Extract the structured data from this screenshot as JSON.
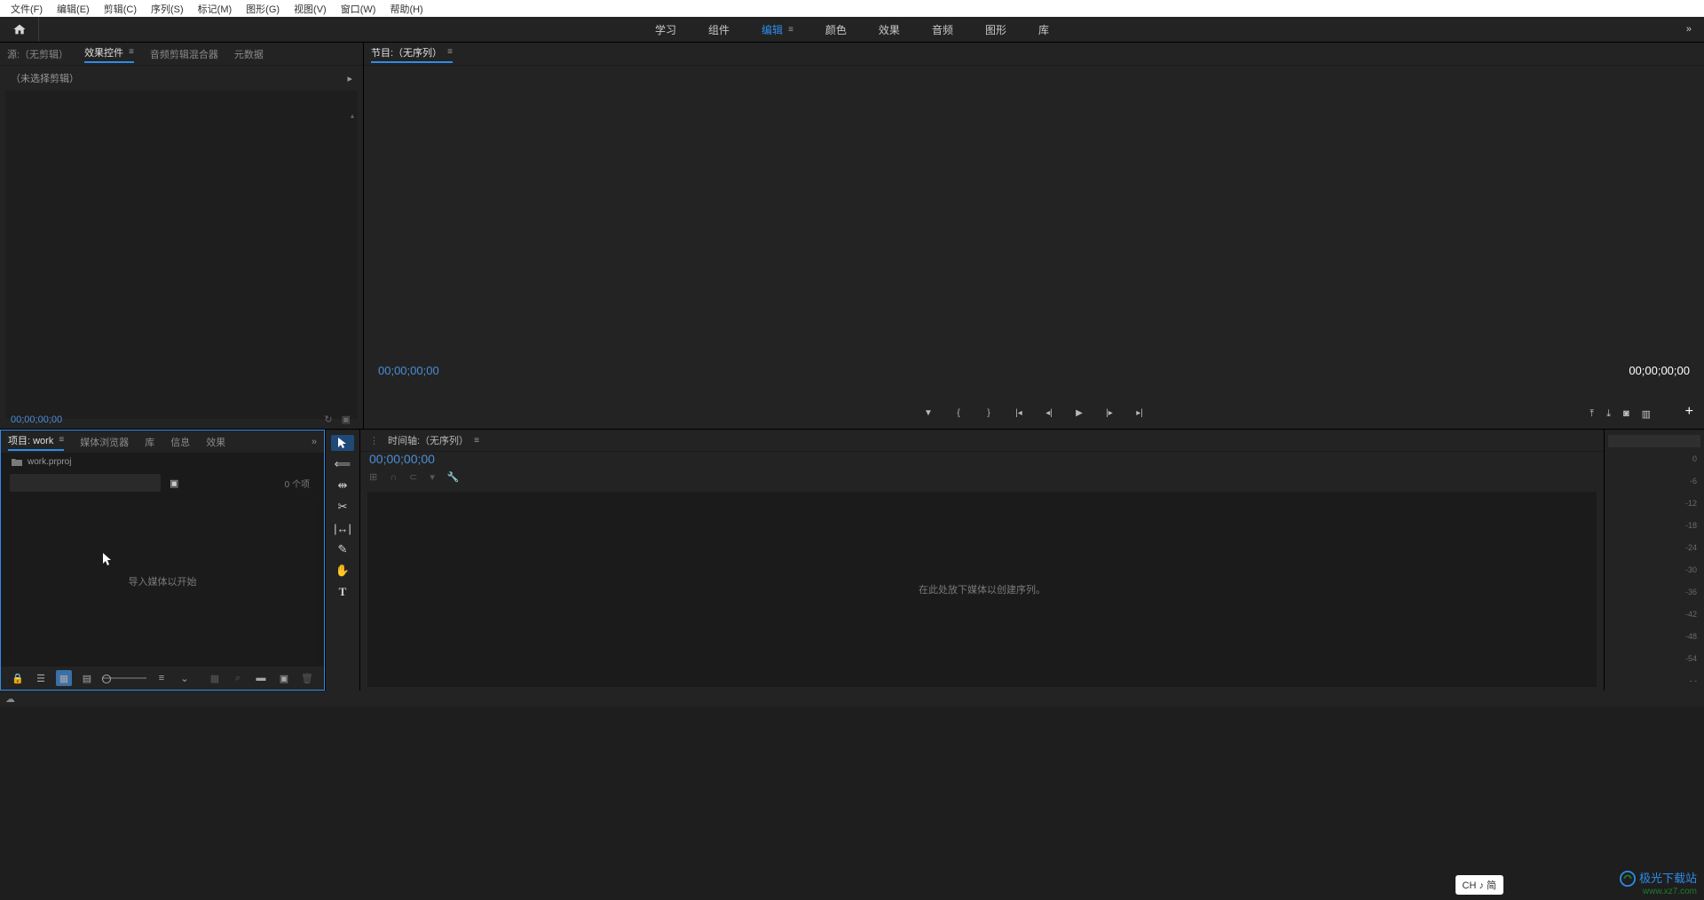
{
  "menubar": {
    "file": "文件(F)",
    "edit": "编辑(E)",
    "clip": "剪辑(C)",
    "sequence": "序列(S)",
    "marker": "标记(M)",
    "graphics": "图形(G)",
    "view": "视图(V)",
    "window": "窗口(W)",
    "help": "帮助(H)"
  },
  "workspaces": {
    "learn": "学习",
    "assembly": "组件",
    "editing": "编辑",
    "color": "颜色",
    "effects": "效果",
    "audio": "音频",
    "graphics": "图形",
    "library": "库",
    "more": "»"
  },
  "sourcePanel": {
    "tab_source": "源:（无剪辑）",
    "tab_effectcontrols": "效果控件",
    "tab_audiomixer": "音频剪辑混合器",
    "tab_metadata": "元数据",
    "no_clip_selected": "（未选择剪辑）",
    "timecode": "00;00;00;00"
  },
  "programPanel": {
    "title": "节目:（无序列）",
    "tc_left": "00;00;00;00",
    "tc_right": "00;00;00;00"
  },
  "projectPanel": {
    "tab_project": "项目: work",
    "tab_mediabrowser": "媒体浏览器",
    "tab_library": "库",
    "tab_info": "信息",
    "tab_effects": "效果",
    "more": "»",
    "filename": "work.prproj",
    "item_count": "0 个项",
    "empty_hint": "导入媒体以开始"
  },
  "timelinePanel": {
    "title": "时间轴:（无序列）",
    "timecode": "00;00;00;00",
    "drop_hint": "在此处放下媒体以创建序列。"
  },
  "meter": {
    "levels": [
      "0",
      "-6",
      "-12",
      "-18",
      "-24",
      "-30",
      "-36",
      "-42",
      "-48",
      "-54",
      "- -"
    ]
  },
  "ime": {
    "label": "CH ♪ 简"
  },
  "watermark": {
    "line1": "极光下载站",
    "line2": "www.xz7.com"
  }
}
